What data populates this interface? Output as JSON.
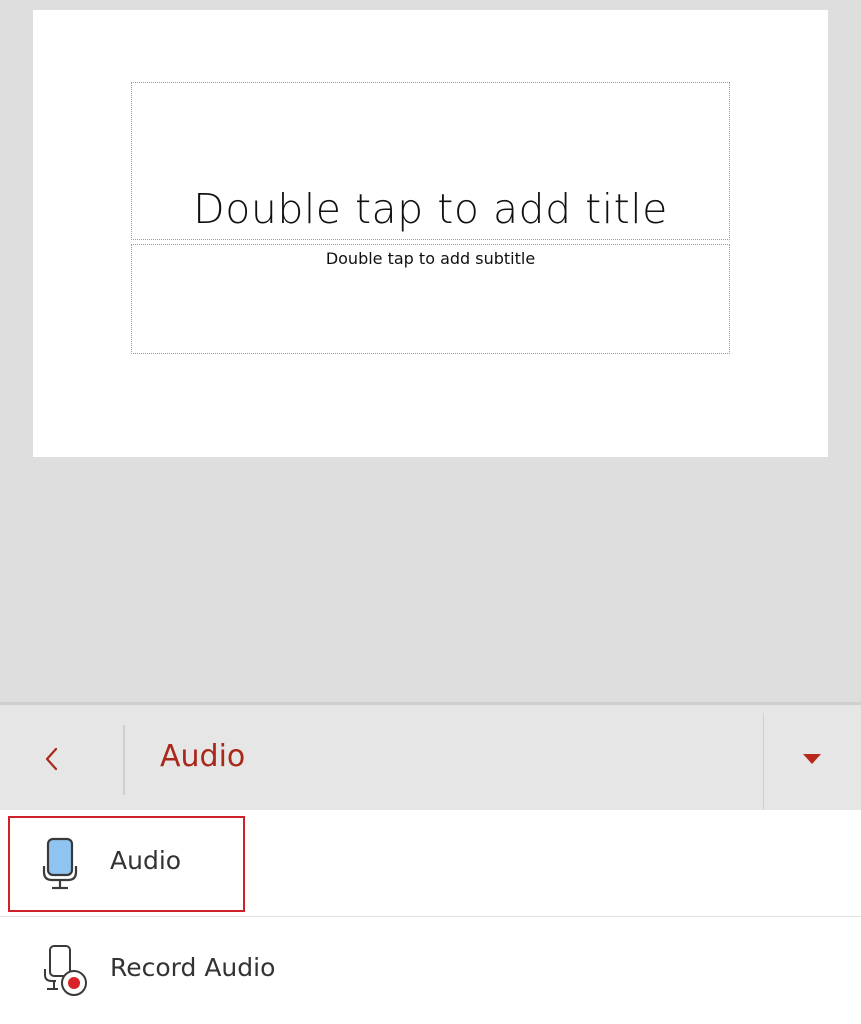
{
  "slide": {
    "title_placeholder": "Double tap to add title",
    "subtitle_placeholder": "Double tap to add subtitle"
  },
  "toolbar": {
    "title": "Audio",
    "accent_color": "#a8281a",
    "back_icon": "chevron-left-icon",
    "dropdown_icon": "caret-down-icon"
  },
  "menu": {
    "items": [
      {
        "label": "Audio",
        "icon": "microphone-icon",
        "highlighted": true
      },
      {
        "label": "Record Audio",
        "icon": "record-audio-icon",
        "highlighted": false
      }
    ]
  },
  "colors": {
    "highlight": "#d0202a",
    "mic_fill": "#8fc3f0",
    "record_dot": "#d9232b"
  }
}
